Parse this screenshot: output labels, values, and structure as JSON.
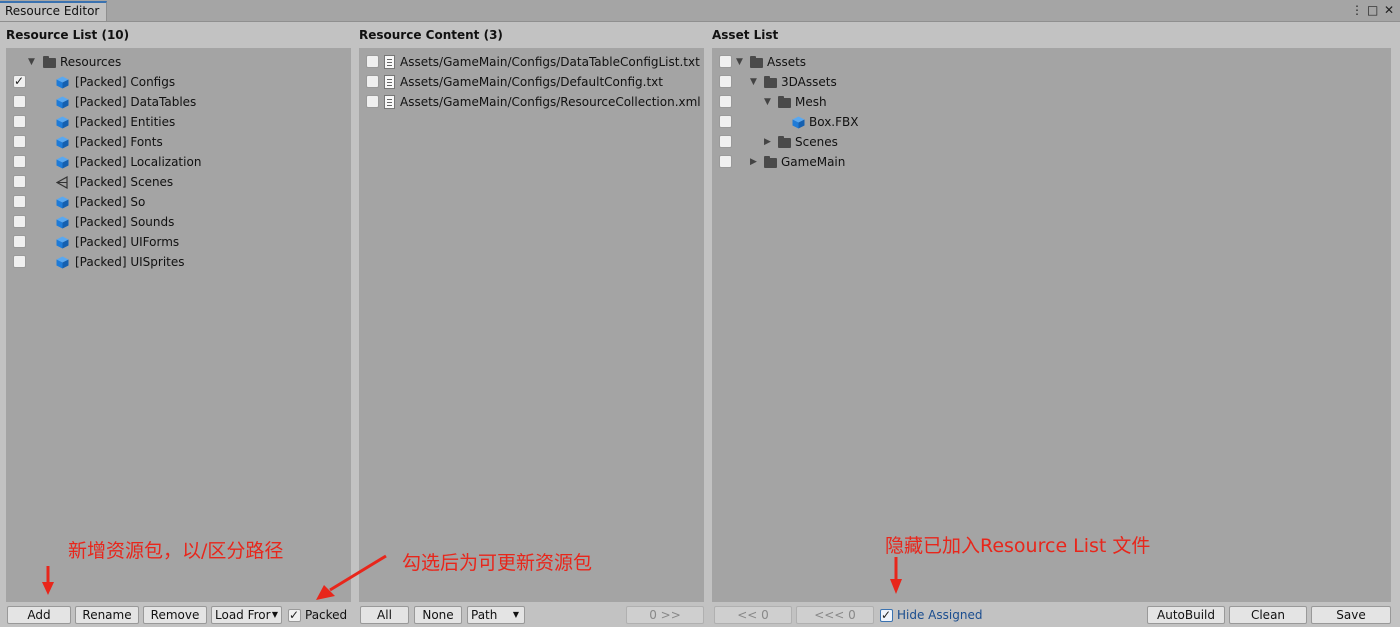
{
  "window": {
    "tab": "Resource Editor"
  },
  "resource_list": {
    "title": "Resource List (10)",
    "root": "Resources",
    "items": [
      {
        "label": "[Packed] Configs",
        "checked": true,
        "icon": "cube-icon"
      },
      {
        "label": "[Packed] DataTables",
        "checked": false,
        "icon": "cube-icon"
      },
      {
        "label": "[Packed] Entities",
        "checked": false,
        "icon": "cube-icon"
      },
      {
        "label": "[Packed] Fonts",
        "checked": false,
        "icon": "cube-icon"
      },
      {
        "label": "[Packed] Localization",
        "checked": false,
        "icon": "cube-icon"
      },
      {
        "label": "[Packed] Scenes",
        "checked": false,
        "icon": "unity-scene-icon"
      },
      {
        "label": "[Packed] So",
        "checked": false,
        "icon": "cube-icon"
      },
      {
        "label": "[Packed] Sounds",
        "checked": false,
        "icon": "cube-icon"
      },
      {
        "label": "[Packed] UIForms",
        "checked": false,
        "icon": "cube-icon"
      },
      {
        "label": "[Packed] UISprites",
        "checked": false,
        "icon": "cube-icon"
      }
    ]
  },
  "resource_content": {
    "title": "Resource Content (3)",
    "items": [
      "Assets/GameMain/Configs/DataTableConfigList.txt",
      "Assets/GameMain/Configs/DefaultConfig.txt",
      "Assets/GameMain/Configs/ResourceCollection.xml"
    ]
  },
  "asset_list": {
    "title": "Asset List",
    "items": [
      {
        "label": "Assets",
        "type": "folder",
        "expanded": true
      },
      {
        "label": "3DAssets",
        "type": "folder",
        "expanded": true
      },
      {
        "label": "Mesh",
        "type": "folder",
        "expanded": true
      },
      {
        "label": "Box.FBX",
        "type": "model"
      },
      {
        "label": "Scenes",
        "type": "folder",
        "expanded": false
      },
      {
        "label": "GameMain",
        "type": "folder",
        "expanded": false
      }
    ]
  },
  "toolbar": {
    "add": "Add",
    "rename": "Rename",
    "remove": "Remove",
    "load_from": "Load Fror",
    "packed": "Packed",
    "packed_checked": true,
    "all": "All",
    "none": "None",
    "path": "Path",
    "move_right": "0 >>",
    "move_left": "<< 0",
    "move_left_all": "<<< 0",
    "hide_assigned": "Hide Assigned",
    "hide_assigned_checked": true,
    "autobuild": "AutoBuild",
    "clean": "Clean",
    "save": "Save"
  },
  "annotations": {
    "add_note": "新增资源包，以/区分路径",
    "packed_note": "勾选后为可更新资源包",
    "hide_note": "隐藏已加入Resource List 文件"
  },
  "colors": {
    "accent": "#3a72b0",
    "annotation": "#e8261b",
    "cube": "#1e7bd8"
  }
}
